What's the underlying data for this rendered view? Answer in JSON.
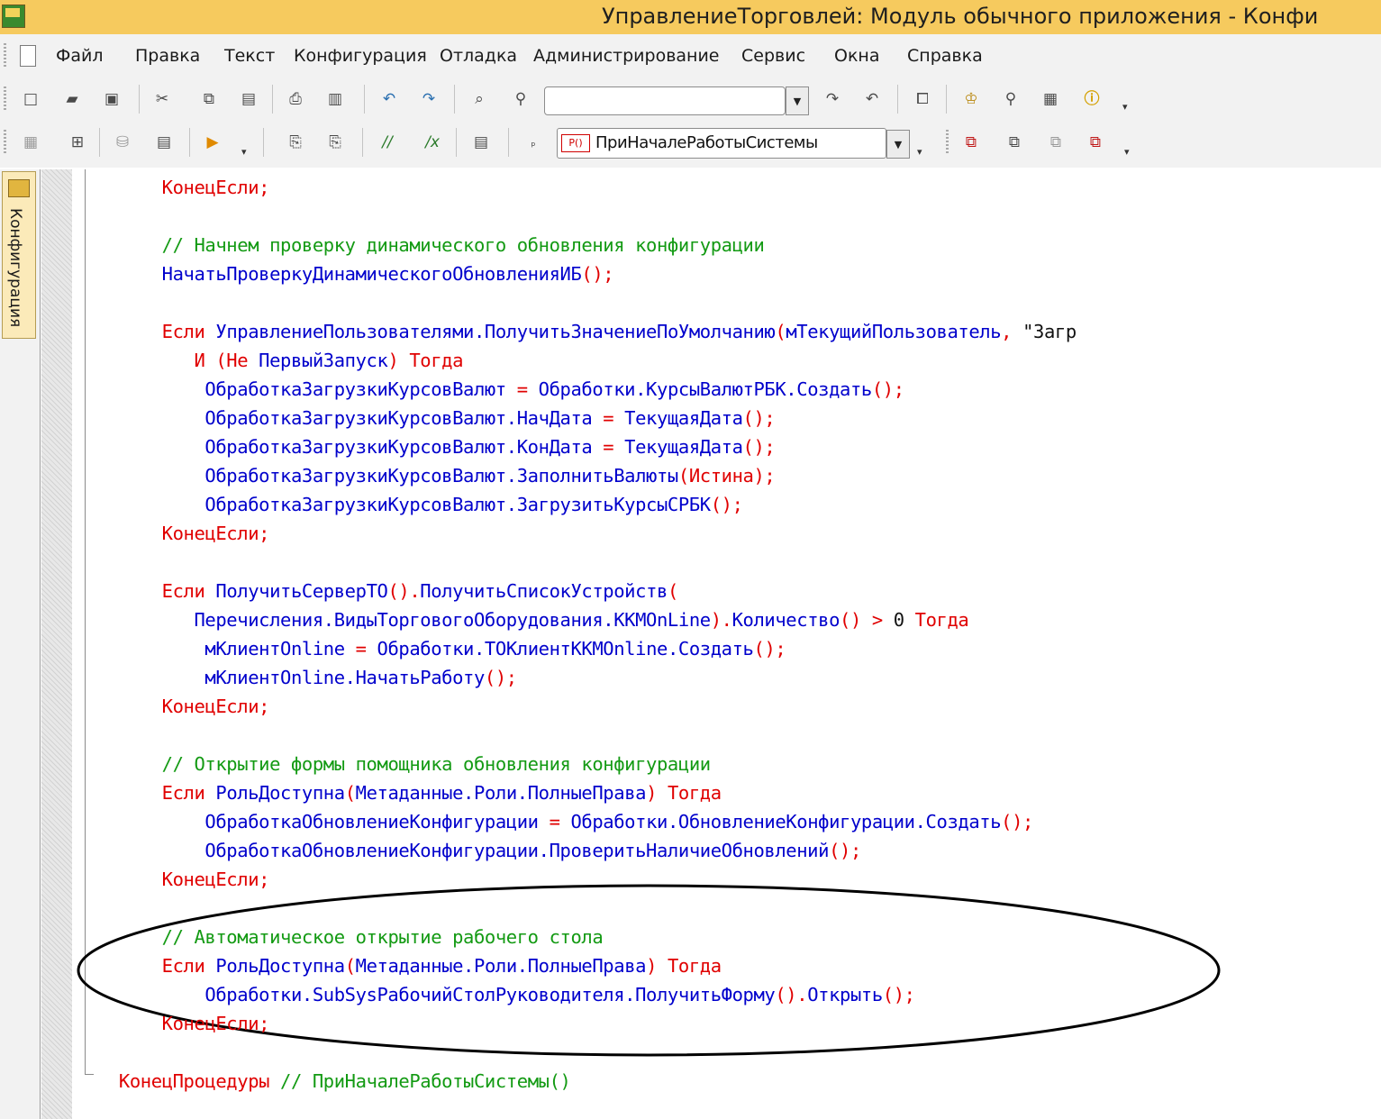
{
  "window": {
    "title": "УправлениеТорговлей: Модуль обычного приложения - Конфи"
  },
  "menu": {
    "items": [
      "Файл",
      "Правка",
      "Текст",
      "Конфигурация",
      "Отладка",
      "Администрирование",
      "Сервис",
      "Окна",
      "Справка"
    ]
  },
  "toolbar2": {
    "procedure_tag": "P()",
    "procedure_value": "ПриНачалеРаботыСистемы"
  },
  "side_panel": {
    "tab_label": "Конфигурация"
  },
  "code": {
    "lines": [
      [
        [
          "      ",
          "sp"
        ],
        [
          "КонецЕсли;",
          "kw"
        ]
      ],
      [],
      [
        [
          "      ",
          "sp"
        ],
        [
          "// Начнем проверку динамического обновления конфигурации",
          "cm"
        ]
      ],
      [
        [
          "      ",
          "sp"
        ],
        [
          "НачатьПроверкуДинамическогоОбновленияИБ",
          "id"
        ],
        [
          "();",
          "op"
        ]
      ],
      [],
      [
        [
          "      ",
          "sp"
        ],
        [
          "Если ",
          "kw"
        ],
        [
          "УправлениеПользователями.ПолучитьЗначениеПоУмолчанию",
          "id"
        ],
        [
          "(",
          "op"
        ],
        [
          "мТекущийПользователь",
          "id"
        ],
        [
          ", ",
          "op"
        ],
        [
          "\"Загр",
          "str"
        ]
      ],
      [
        [
          "         ",
          "sp"
        ],
        [
          "И (Не ",
          "kw"
        ],
        [
          "ПервыйЗапуск",
          "id"
        ],
        [
          ") Тогда",
          "kw"
        ]
      ],
      [
        [
          "          ",
          "sp"
        ],
        [
          "ОбработкаЗагрузкиКурсовВалют ",
          "id"
        ],
        [
          "= ",
          "op"
        ],
        [
          "Обработки.КурсыВалютРБК.Создать",
          "id"
        ],
        [
          "();",
          "op"
        ]
      ],
      [
        [
          "          ",
          "sp"
        ],
        [
          "ОбработкаЗагрузкиКурсовВалют.НачДата ",
          "id"
        ],
        [
          "= ",
          "op"
        ],
        [
          "ТекущаяДата",
          "id"
        ],
        [
          "();",
          "op"
        ]
      ],
      [
        [
          "          ",
          "sp"
        ],
        [
          "ОбработкаЗагрузкиКурсовВалют.КонДата ",
          "id"
        ],
        [
          "= ",
          "op"
        ],
        [
          "ТекущаяДата",
          "id"
        ],
        [
          "();",
          "op"
        ]
      ],
      [
        [
          "          ",
          "sp"
        ],
        [
          "ОбработкаЗагрузкиКурсовВалют.ЗаполнитьВалюты",
          "id"
        ],
        [
          "(Истина);",
          "op"
        ]
      ],
      [
        [
          "          ",
          "sp"
        ],
        [
          "ОбработкаЗагрузкиКурсовВалют.ЗагрузитьКурсыСРБК",
          "id"
        ],
        [
          "();",
          "op"
        ]
      ],
      [
        [
          "      ",
          "sp"
        ],
        [
          "КонецЕсли;",
          "kw"
        ]
      ],
      [],
      [
        [
          "      ",
          "sp"
        ],
        [
          "Если ",
          "kw"
        ],
        [
          "ПолучитьСерверТО",
          "id"
        ],
        [
          "().",
          "op"
        ],
        [
          "ПолучитьСписокУстройств",
          "id"
        ],
        [
          "(",
          "op"
        ]
      ],
      [
        [
          "         ",
          "sp"
        ],
        [
          "Перечисления.ВидыТоргового​Оборудования.ККМOnLine",
          "id"
        ],
        [
          ").",
          "op"
        ],
        [
          "Количество",
          "id"
        ],
        [
          "() > ",
          "op"
        ],
        [
          "0 ",
          "str"
        ],
        [
          "Тогда",
          "kw"
        ]
      ],
      [
        [
          "          ",
          "sp"
        ],
        [
          "мКлиентOnline ",
          "id"
        ],
        [
          "= ",
          "op"
        ],
        [
          "Обработки.ТОКлиентККМOnline.Создать",
          "id"
        ],
        [
          "();",
          "op"
        ]
      ],
      [
        [
          "          ",
          "sp"
        ],
        [
          "мКлиентOnline.НачатьРаботу",
          "id"
        ],
        [
          "();",
          "op"
        ]
      ],
      [
        [
          "      ",
          "sp"
        ],
        [
          "КонецЕсли;",
          "kw"
        ]
      ],
      [],
      [
        [
          "      ",
          "sp"
        ],
        [
          "// Открытие формы помощника обновления конфигурации",
          "cm"
        ]
      ],
      [
        [
          "      ",
          "sp"
        ],
        [
          "Если ",
          "kw"
        ],
        [
          "РольДоступна",
          "id"
        ],
        [
          "(",
          "op"
        ],
        [
          "Метаданные.Роли.ПолныеПрава",
          "id"
        ],
        [
          ") Тогда",
          "kw"
        ]
      ],
      [
        [
          "          ",
          "sp"
        ],
        [
          "ОбработкаОбновлениеКонфигурации ",
          "id"
        ],
        [
          "= ",
          "op"
        ],
        [
          "Обработки.ОбновлениеКонфигурации.Создать",
          "id"
        ],
        [
          "();",
          "op"
        ]
      ],
      [
        [
          "          ",
          "sp"
        ],
        [
          "ОбработкаОбновлениеКонфигурации.ПроверитьНаличиеОбновлений",
          "id"
        ],
        [
          "();",
          "op"
        ]
      ],
      [
        [
          "      ",
          "sp"
        ],
        [
          "КонецЕсли;",
          "kw"
        ]
      ],
      [],
      [
        [
          "      ",
          "sp"
        ],
        [
          "// Автоматическое открытие рабочего стола",
          "cm"
        ]
      ],
      [
        [
          "      ",
          "sp"
        ],
        [
          "Если ",
          "kw"
        ],
        [
          "РольДоступна",
          "id"
        ],
        [
          "(",
          "op"
        ],
        [
          "Метаданные.Роли.ПолныеПрава",
          "id"
        ],
        [
          ") Тогда",
          "kw"
        ]
      ],
      [
        [
          "          ",
          "sp"
        ],
        [
          "Обработки.SubSysРабочийСтолРуководителя.ПолучитьФорму",
          "id"
        ],
        [
          "().",
          "op"
        ],
        [
          "Открыть",
          "id"
        ],
        [
          "();",
          "op"
        ]
      ],
      [
        [
          "      ",
          "sp"
        ],
        [
          "КонецЕсли;",
          "kw"
        ]
      ],
      [],
      [
        [
          "  ",
          "sp"
        ],
        [
          "КонецПроцедуры ",
          "kw"
        ],
        [
          "// ПриНачалеРаботыСистемы()",
          "cm"
        ]
      ]
    ]
  },
  "colors": {
    "keyword": "#e00000",
    "identifier": "#0000cc",
    "comment": "#139a13",
    "titlebar": "#f6ca5e"
  }
}
